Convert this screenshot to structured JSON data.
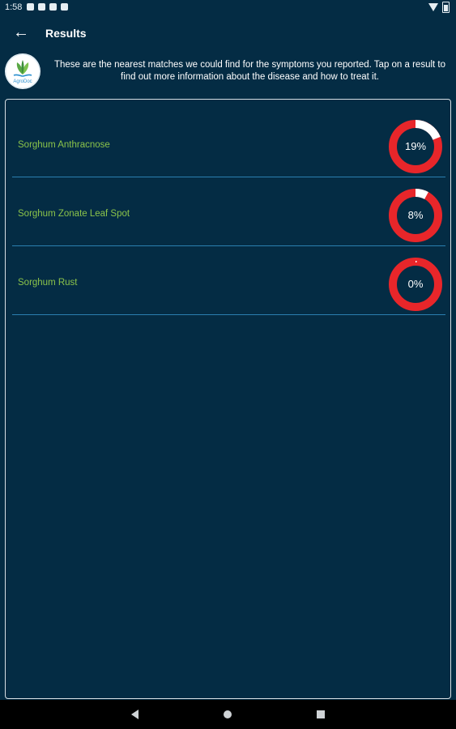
{
  "status_bar": {
    "time": "1:58"
  },
  "app_bar": {
    "title": "Results",
    "back_icon": "arrow-left-icon"
  },
  "intro": {
    "logo_text": "AgroDoc",
    "message": "These are the nearest matches we could find for the symptoms you reported. Tap on a result to find out more information about the disease and how to treat it."
  },
  "results": [
    {
      "name": "Sorghum Anthracnose",
      "percent": 19,
      "label": "19%"
    },
    {
      "name": "Sorghum Zonate Leaf Spot",
      "percent": 8,
      "label": "8%"
    },
    {
      "name": "Sorghum Rust",
      "percent": 0,
      "label": "0%"
    }
  ],
  "colors": {
    "background": "#042c44",
    "ring_track": "#e8262a",
    "ring_progress": "#ffffff",
    "result_text": "#8bc34a",
    "divider": "#2a7fb0"
  }
}
